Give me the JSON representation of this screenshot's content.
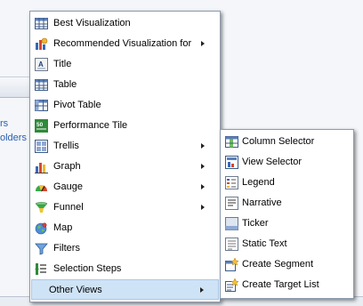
{
  "background": {
    "link_lines": [
      "rs",
      "olders"
    ]
  },
  "main_menu": {
    "items": [
      {
        "label": "Best Visualization",
        "icon": "best-visualization-icon",
        "submenu": false
      },
      {
        "label": "Recommended Visualization for",
        "icon": "recommended-visualization-icon",
        "submenu": true
      },
      {
        "label": "Title",
        "icon": "title-icon",
        "submenu": false
      },
      {
        "label": "Table",
        "icon": "table-icon",
        "submenu": false
      },
      {
        "label": "Pivot Table",
        "icon": "pivot-table-icon",
        "submenu": false
      },
      {
        "label": "Performance Tile",
        "icon": "performance-tile-icon",
        "submenu": false
      },
      {
        "label": "Trellis",
        "icon": "trellis-icon",
        "submenu": true
      },
      {
        "label": "Graph",
        "icon": "graph-icon",
        "submenu": true
      },
      {
        "label": "Gauge",
        "icon": "gauge-icon",
        "submenu": true
      },
      {
        "label": "Funnel",
        "icon": "funnel-icon",
        "submenu": true
      },
      {
        "label": "Map",
        "icon": "map-icon",
        "submenu": false
      },
      {
        "label": "Filters",
        "icon": "filters-icon",
        "submenu": false
      },
      {
        "label": "Selection Steps",
        "icon": "selection-steps-icon",
        "submenu": false
      },
      {
        "label": "Other Views",
        "icon": "",
        "submenu": true,
        "highlighted": true
      }
    ],
    "performance_tile_icon_text": "50"
  },
  "sub_menu": {
    "items": [
      {
        "label": "Column Selector",
        "icon": "column-selector-icon"
      },
      {
        "label": "View Selector",
        "icon": "view-selector-icon"
      },
      {
        "label": "Legend",
        "icon": "legend-icon"
      },
      {
        "label": "Narrative",
        "icon": "narrative-icon"
      },
      {
        "label": "Ticker",
        "icon": "ticker-icon"
      },
      {
        "label": "Static Text",
        "icon": "static-text-icon"
      },
      {
        "label": "Create Segment",
        "icon": "create-segment-icon"
      },
      {
        "label": "Create Target List",
        "icon": "create-target-list-icon"
      }
    ]
  },
  "colors": {
    "highlight": "#cfe3f6",
    "menu_border": "#8e9aac",
    "link": "#2a5db0"
  }
}
